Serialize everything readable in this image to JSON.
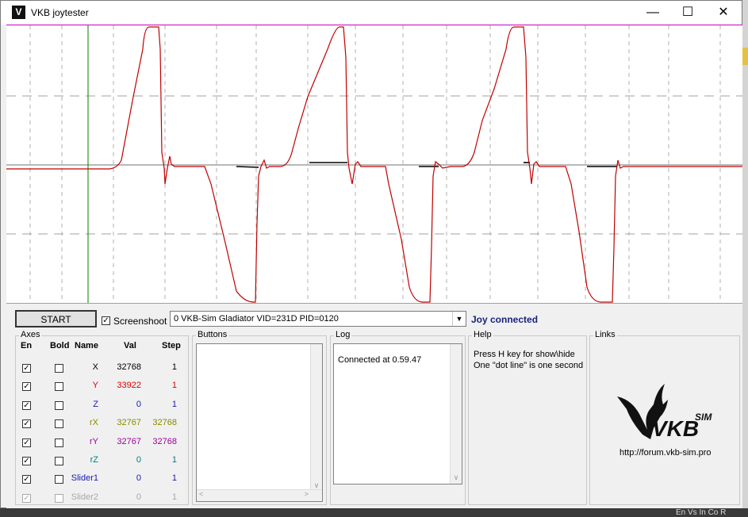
{
  "window": {
    "title": "VKB joytester"
  },
  "controls": {
    "start_label": "START",
    "screenshot_label": "Screenshoot",
    "screenshot_checked": true,
    "device_selected": "0  VKB-Sim Gladiator  VID=231D PID=0120",
    "status": "Joy connected",
    "status_color": "#1a237e"
  },
  "axes": {
    "group_label": "Axes",
    "headers": {
      "en": "En",
      "bold": "Bold",
      "name": "Name",
      "val": "Val",
      "step": "Step"
    },
    "rows": [
      {
        "name": "X",
        "val": "32768",
        "step": "1",
        "color": "#000000",
        "enabled": true,
        "bold": false,
        "disabled": false
      },
      {
        "name": "Y",
        "val": "33922",
        "step": "1",
        "color": "#e00000",
        "enabled": true,
        "bold": false,
        "disabled": false
      },
      {
        "name": "Z",
        "val": "0",
        "step": "1",
        "color": "#1a1ab0",
        "enabled": true,
        "bold": false,
        "disabled": false
      },
      {
        "name": "rX",
        "val": "32767",
        "step": "32768",
        "color": "#8a8a00",
        "enabled": true,
        "bold": false,
        "disabled": false
      },
      {
        "name": "rY",
        "val": "32767",
        "step": "32768",
        "color": "#a000a0",
        "enabled": true,
        "bold": false,
        "disabled": false
      },
      {
        "name": "rZ",
        "val": "0",
        "step": "1",
        "color": "#008080",
        "enabled": true,
        "bold": false,
        "disabled": false
      },
      {
        "name": "Slider1",
        "val": "0",
        "step": "1",
        "color": "#1a1ab0",
        "enabled": true,
        "bold": false,
        "disabled": false
      },
      {
        "name": "Slider2",
        "val": "0",
        "step": "1",
        "color": "#a8a8a8",
        "enabled": true,
        "bold": false,
        "disabled": true
      }
    ]
  },
  "buttons_group": {
    "label": "Buttons"
  },
  "log": {
    "label": "Log",
    "text": "Connected at 0.59.47"
  },
  "help": {
    "label": "Help",
    "line1": "Press H key for show\\hide",
    "line2": "One \"dot line\" is one second"
  },
  "links": {
    "label": "Links",
    "url": "http://forum.vkb-sim.pro",
    "logo_text": "VKB",
    "logo_sup": "SIM"
  },
  "desktop": {
    "taskbar_text": "En  Vs  In  Co  R"
  }
}
